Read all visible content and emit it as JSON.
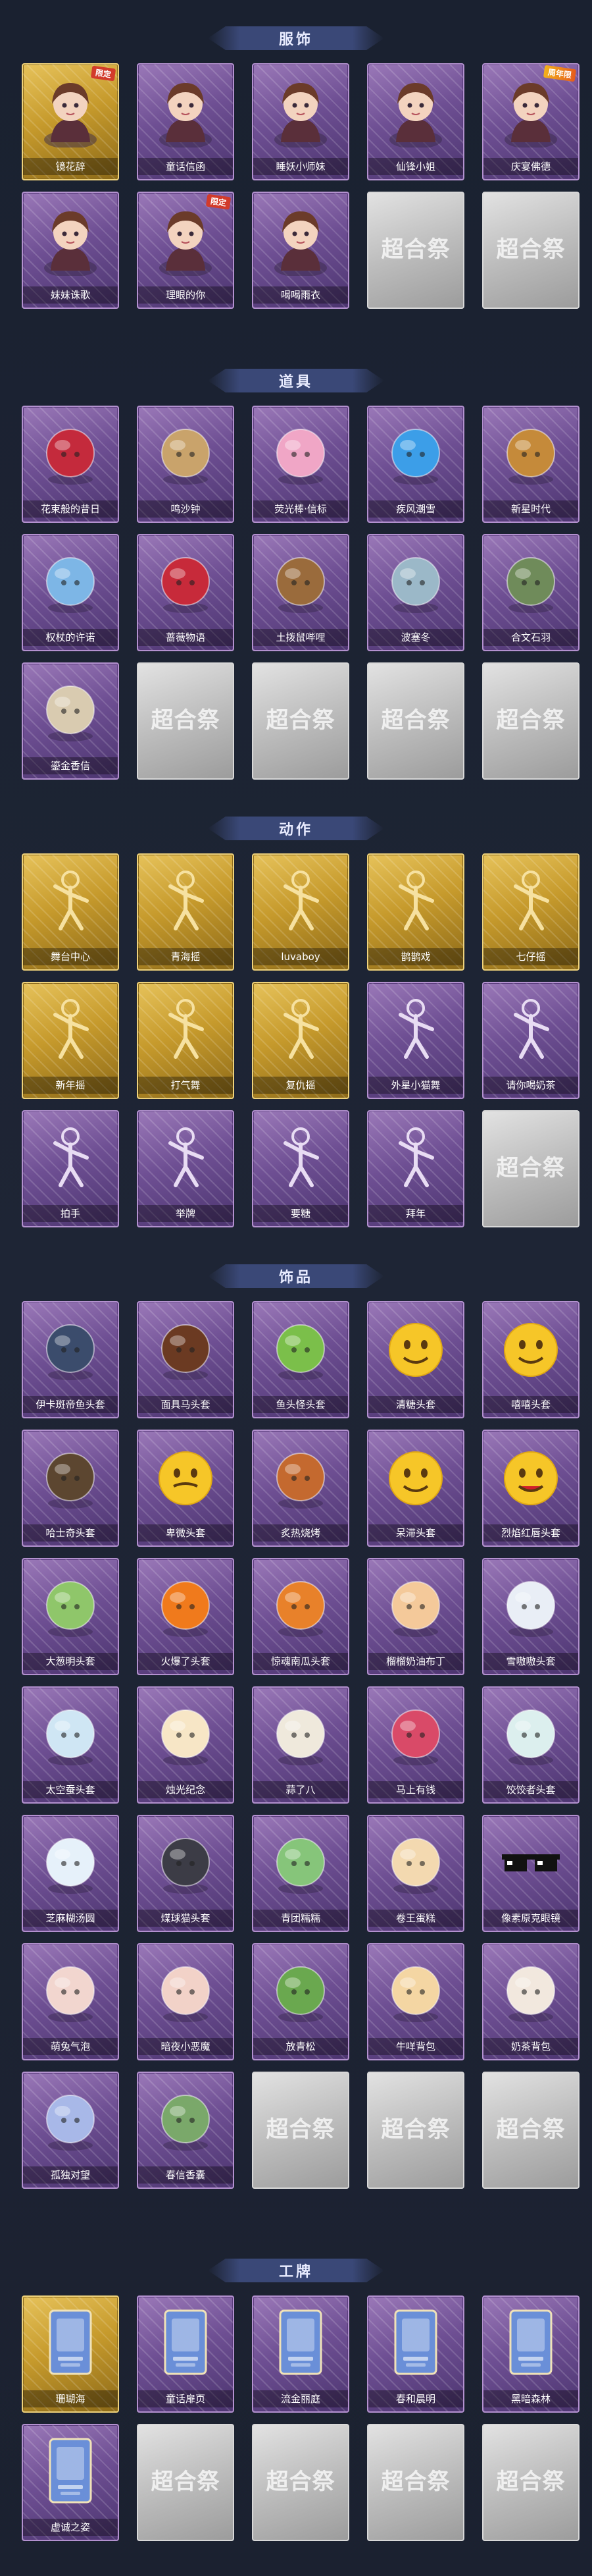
{
  "sections": [
    {
      "title": "服饰",
      "items": [
        {
          "label": "镜花辞",
          "tier": "gold",
          "badge": "限定",
          "icon": "character-portrait-red-hood"
        },
        {
          "label": "童话信函",
          "tier": "purple",
          "icon": "character-portrait-curly-hair"
        },
        {
          "label": "睡妖小师妹",
          "tier": "purple",
          "icon": "character-portrait-hooded"
        },
        {
          "label": "仙锋小姐",
          "tier": "purple",
          "icon": "character-portrait-boy"
        },
        {
          "label": "庆宴佛德",
          "tier": "purple",
          "badge": "周年限",
          "icon": "character-portrait-hat"
        },
        {
          "label": "妹妹诛歌",
          "tier": "purple",
          "icon": "character-portrait-girl"
        },
        {
          "label": "理眼的你",
          "tier": "purple",
          "badge": "限定",
          "icon": "character-portrait-wide-hat"
        },
        {
          "label": "喝喝雨衣",
          "tier": "purple",
          "icon": "character-portrait-frog-hood"
        },
        {
          "label": "",
          "tier": "empty"
        },
        {
          "label": "",
          "tier": "empty"
        }
      ]
    },
    {
      "title": "道具",
      "items": [
        {
          "label": "花束般的昔日",
          "tier": "purple",
          "icon": "rose-icon"
        },
        {
          "label": "鸣沙钟",
          "tier": "purple",
          "icon": "clock-icon"
        },
        {
          "label": "荧光棒·信标",
          "tier": "purple",
          "icon": "wand-icon"
        },
        {
          "label": "疾风潮雪",
          "tier": "purple",
          "icon": "goggles-icon"
        },
        {
          "label": "新星时代",
          "tier": "purple",
          "icon": "pistol-icon"
        },
        {
          "label": "权杖的许诺",
          "tier": "purple",
          "icon": "scepter-icon"
        },
        {
          "label": "蔷薇物语",
          "tier": "purple",
          "icon": "medkit-icon"
        },
        {
          "label": "土拨鼠哔哩",
          "tier": "purple",
          "icon": "groundhog-icon"
        },
        {
          "label": "波塞冬",
          "tier": "purple",
          "icon": "trident-icon"
        },
        {
          "label": "合文石羽",
          "tier": "purple",
          "icon": "lantern-icon"
        },
        {
          "label": "鎏金香信",
          "tier": "purple",
          "icon": "fan-icon"
        },
        {
          "label": "",
          "tier": "empty"
        },
        {
          "label": "",
          "tier": "empty"
        },
        {
          "label": "",
          "tier": "empty"
        },
        {
          "label": "",
          "tier": "empty"
        }
      ]
    },
    {
      "title": "动作",
      "items": [
        {
          "label": "舞台中心",
          "tier": "gold",
          "icon": "pose-icon"
        },
        {
          "label": "青海摇",
          "tier": "gold",
          "icon": "pose-icon"
        },
        {
          "label": "luvaboy",
          "tier": "gold",
          "icon": "pose-icon"
        },
        {
          "label": "鹊鹊戏",
          "tier": "gold",
          "icon": "pose-icon"
        },
        {
          "label": "七仔摇",
          "tier": "gold",
          "icon": "pose-icon"
        },
        {
          "label": "新年摇",
          "tier": "gold",
          "icon": "pose-icon"
        },
        {
          "label": "打气舞",
          "tier": "gold",
          "icon": "pose-icon"
        },
        {
          "label": "复仇摇",
          "tier": "gold",
          "icon": "pose-icon"
        },
        {
          "label": "外星小猫舞",
          "tier": "purple",
          "icon": "pose-icon"
        },
        {
          "label": "请你喝奶茶",
          "tier": "purple",
          "icon": "pose-icon"
        },
        {
          "label": "拍手",
          "tier": "purple",
          "icon": "pose-icon"
        },
        {
          "label": "举牌",
          "tier": "purple",
          "icon": "pose-icon"
        },
        {
          "label": "要糖",
          "tier": "purple",
          "icon": "pose-icon"
        },
        {
          "label": "拜年",
          "tier": "purple",
          "icon": "pose-icon"
        },
        {
          "label": "",
          "tier": "empty"
        }
      ]
    },
    {
      "title": "饰品",
      "items": [
        {
          "label": "伊卡斑帝鱼头套",
          "tier": "purple",
          "icon": "fish-head-icon"
        },
        {
          "label": "面具马头套",
          "tier": "purple",
          "icon": "horse-head-icon"
        },
        {
          "label": "鱼头怪头套",
          "tier": "purple",
          "icon": "frog-head-icon"
        },
        {
          "label": "清糖头套",
          "tier": "purple",
          "icon": "smiley-icon"
        },
        {
          "label": "嘻嘻头套",
          "tier": "purple",
          "icon": "grin-icon"
        },
        {
          "label": "哈士奇头套",
          "tier": "purple",
          "icon": "dog-head-icon"
        },
        {
          "label": "卑微头套",
          "tier": "purple",
          "icon": "sad-face-icon"
        },
        {
          "label": "炙热烧烤",
          "tier": "purple",
          "icon": "sausage-icon"
        },
        {
          "label": "呆滞头套",
          "tier": "purple",
          "icon": "dazed-face-icon"
        },
        {
          "label": "烈焰红唇头套",
          "tier": "purple",
          "icon": "lips-face-icon"
        },
        {
          "label": "大葱明头套",
          "tier": "purple",
          "icon": "bokchoy-icon"
        },
        {
          "label": "火爆了头套",
          "tier": "purple",
          "icon": "fire-icon"
        },
        {
          "label": "惊魂南瓜头套",
          "tier": "purple",
          "icon": "pumpkin-icon"
        },
        {
          "label": "榴榴奶油布丁",
          "tier": "purple",
          "icon": "pudding-icon"
        },
        {
          "label": "雪嗷嗷头套",
          "tier": "purple",
          "icon": "snowman-icon"
        },
        {
          "label": "太空蚕头套",
          "tier": "purple",
          "icon": "egg-icon"
        },
        {
          "label": "烛光纪念",
          "tier": "purple",
          "icon": "candle-icon"
        },
        {
          "label": "蒜了八",
          "tier": "purple",
          "icon": "garlic-icon"
        },
        {
          "label": "马上有钱",
          "tier": "purple",
          "icon": "horse-toy-icon"
        },
        {
          "label": "饺饺者头套",
          "tier": "purple",
          "icon": "dumpling-icon"
        },
        {
          "label": "芝麻糊汤圆",
          "tier": "purple",
          "icon": "tangyuan-icon"
        },
        {
          "label": "煤球猫头套",
          "tier": "purple",
          "icon": "cat-head-icon"
        },
        {
          "label": "青团糯糯",
          "tier": "purple",
          "icon": "qingtuan-icon"
        },
        {
          "label": "卷王蛋糕",
          "tier": "purple",
          "icon": "cake-roll-icon"
        },
        {
          "label": "像素原克眼镜",
          "tier": "purple",
          "icon": "pixel-glasses-icon"
        },
        {
          "label": "萌兔气泡",
          "tier": "purple",
          "icon": "bunny-icon"
        },
        {
          "label": "暗夜小恶魔",
          "tier": "purple",
          "icon": "devil-icon"
        },
        {
          "label": "放青松",
          "tier": "purple",
          "icon": "bonsai-icon"
        },
        {
          "label": "牛咩背包",
          "tier": "purple",
          "icon": "backpack-icon"
        },
        {
          "label": "奶茶背包",
          "tier": "purple",
          "icon": "milktea-bag-icon"
        },
        {
          "label": "孤独对望",
          "tier": "purple",
          "icon": "pendant-icon"
        },
        {
          "label": "春信香囊",
          "tier": "purple",
          "icon": "sachet-icon"
        },
        {
          "label": "",
          "tier": "empty"
        },
        {
          "label": "",
          "tier": "empty"
        },
        {
          "label": "",
          "tier": "empty"
        }
      ]
    },
    {
      "title": "工牌",
      "items": [
        {
          "label": "珊瑚海",
          "tier": "gold",
          "icon": "card-icon"
        },
        {
          "label": "童话扉页",
          "tier": "purple",
          "icon": "card-icon"
        },
        {
          "label": "流金丽庭",
          "tier": "purple",
          "icon": "card-icon"
        },
        {
          "label": "春和晨明",
          "tier": "purple",
          "icon": "card-icon"
        },
        {
          "label": "黑暗森林",
          "tier": "purple",
          "icon": "card-icon"
        },
        {
          "label": "虚诚之姿",
          "tier": "purple",
          "icon": "card-icon"
        },
        {
          "label": "",
          "tier": "empty"
        },
        {
          "label": "",
          "tier": "empty"
        },
        {
          "label": "",
          "tier": "empty"
        },
        {
          "label": "",
          "tier": "empty"
        }
      ]
    }
  ],
  "empty_watermark": "超合祭",
  "colors": {
    "background": "#1b2130",
    "header_bar": "#3a4877",
    "purple_tier": "#7b5aa0",
    "gold_tier": "#d4a83a",
    "empty_tier": "#c4c4c4"
  }
}
